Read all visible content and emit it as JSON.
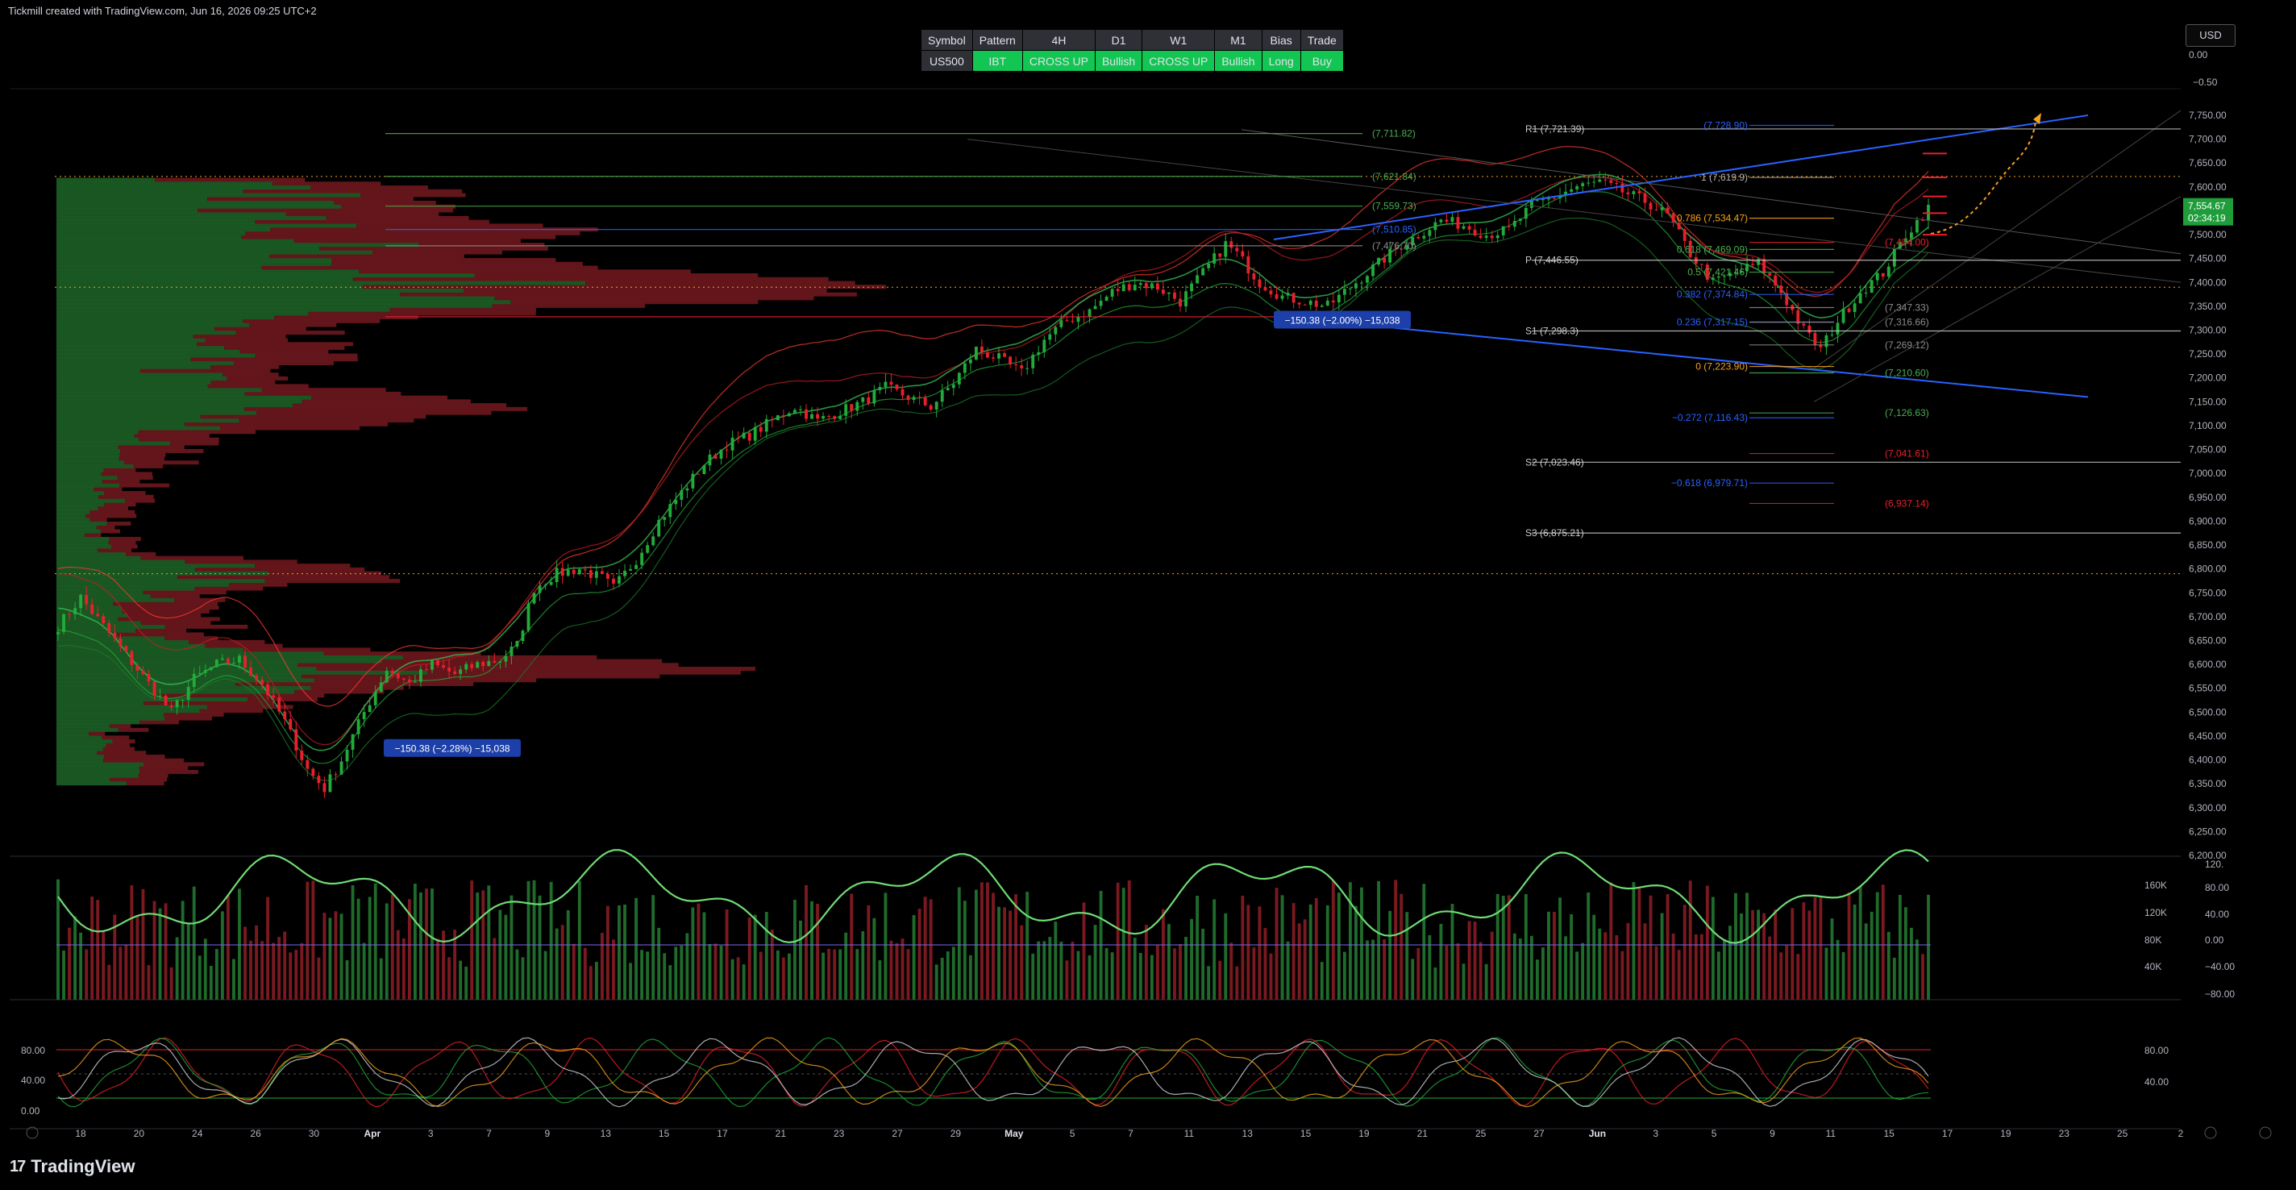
{
  "header": {
    "caption": "Tickmill created with TradingView.com, Jun 16, 2026 09:25 UTC+2",
    "currency": "USD",
    "logo_text": "TradingView",
    "logo_mark": "17"
  },
  "signal_table": {
    "headers": [
      "Symbol",
      "Pattern",
      "4H",
      "D1",
      "W1",
      "M1",
      "Bias",
      "Trade"
    ],
    "values": [
      "US500",
      "IBT",
      "CROSS UP",
      "Bullish",
      "CROSS UP",
      "Bullish",
      "Long",
      "Buy"
    ],
    "value_colors": [
      "#2f3036",
      "#13c552",
      "#13c552",
      "#13c552",
      "#13c552",
      "#13c552",
      "#13c552",
      "#13c552"
    ]
  },
  "chart_data": {
    "type": "candlestick",
    "symbol": "US500",
    "colors": {
      "up": "#22ab3a",
      "down": "#e8202c",
      "background": "#000000"
    },
    "price_axis": {
      "ylim": [
        6200,
        7750
      ],
      "ticks": [
        "7,750.00",
        "7,700.00",
        "7,650.00",
        "7,600.00",
        "7,550.00",
        "7,500.00",
        "7,450.00",
        "7,400.00",
        "7,350.00",
        "7,300.00",
        "7,250.00",
        "7,200.00",
        "7,150.00",
        "7,100.00",
        "7,050.00",
        "7,000.00",
        "6,950.00",
        "6,900.00",
        "6,850.00",
        "6,800.00",
        "6,750.00",
        "6,700.00",
        "6,650.00",
        "6,600.00",
        "6,550.00",
        "6,500.00",
        "6,450.00",
        "6,400.00",
        "6,350.00",
        "6,300.00",
        "6,250.00",
        "6,200.00"
      ],
      "top_extra_ticks": [
        "0.00",
        "−0.50"
      ],
      "last_price": "7,554.67",
      "countdown": "02:34:19"
    },
    "time_axis": {
      "ticks": [
        "18",
        "20",
        "24",
        "26",
        "30",
        "Apr",
        "3",
        "7",
        "9",
        "13",
        "15",
        "17",
        "21",
        "23",
        "27",
        "29",
        "May",
        "5",
        "7",
        "11",
        "13",
        "15",
        "19",
        "21",
        "25",
        "27",
        "Jun",
        "3",
        "5",
        "9",
        "11",
        "15",
        "17",
        "19",
        "23",
        "25",
        "2"
      ],
      "bold_ticks": [
        "Apr",
        "May",
        "Jun"
      ]
    },
    "anchor_path": [
      [
        0,
        6680
      ],
      [
        4,
        6740
      ],
      [
        8,
        6680
      ],
      [
        12,
        6620
      ],
      [
        16,
        6560
      ],
      [
        20,
        6500
      ],
      [
        24,
        6570
      ],
      [
        28,
        6600
      ],
      [
        32,
        6610
      ],
      [
        36,
        6560
      ],
      [
        40,
        6480
      ],
      [
        44,
        6380
      ],
      [
        47,
        6340
      ],
      [
        50,
        6400
      ],
      [
        54,
        6500
      ],
      [
        58,
        6590
      ],
      [
        62,
        6560
      ],
      [
        66,
        6600
      ],
      [
        70,
        6580
      ],
      [
        74,
        6600
      ],
      [
        78,
        6610
      ],
      [
        81,
        6640
      ],
      [
        84,
        6760
      ],
      [
        88,
        6790
      ],
      [
        92,
        6800
      ],
      [
        96,
        6780
      ],
      [
        98,
        6760
      ],
      [
        102,
        6820
      ],
      [
        106,
        6900
      ],
      [
        110,
        6960
      ],
      [
        114,
        7020
      ],
      [
        118,
        7060
      ],
      [
        122,
        7080
      ],
      [
        126,
        7110
      ],
      [
        130,
        7140
      ],
      [
        134,
        7110
      ],
      [
        138,
        7130
      ],
      [
        142,
        7150
      ],
      [
        146,
        7180
      ],
      [
        150,
        7160
      ],
      [
        154,
        7140
      ],
      [
        158,
        7190
      ],
      [
        162,
        7260
      ],
      [
        166,
        7240
      ],
      [
        170,
        7210
      ],
      [
        174,
        7280
      ],
      [
        178,
        7320
      ],
      [
        182,
        7340
      ],
      [
        186,
        7380
      ],
      [
        190,
        7400
      ],
      [
        194,
        7390
      ],
      [
        198,
        7360
      ],
      [
        202,
        7420
      ],
      [
        206,
        7480
      ],
      [
        208,
        7460
      ],
      [
        212,
        7400
      ],
      [
        216,
        7370
      ],
      [
        220,
        7360
      ],
      [
        224,
        7350
      ],
      [
        228,
        7390
      ],
      [
        232,
        7430
      ],
      [
        236,
        7470
      ],
      [
        240,
        7500
      ],
      [
        244,
        7530
      ],
      [
        248,
        7520
      ],
      [
        252,
        7500
      ],
      [
        256,
        7510
      ],
      [
        260,
        7560
      ],
      [
        264,
        7580
      ],
      [
        268,
        7600
      ],
      [
        272,
        7610
      ],
      [
        276,
        7590
      ],
      [
        280,
        7570
      ],
      [
        284,
        7540
      ],
      [
        288,
        7460
      ],
      [
        292,
        7400
      ],
      [
        296,
        7420
      ],
      [
        300,
        7440
      ],
      [
        304,
        7380
      ],
      [
        308,
        7300
      ],
      [
        311,
        7260
      ],
      [
        314,
        7320
      ],
      [
        318,
        7380
      ],
      [
        322,
        7420
      ],
      [
        326,
        7500
      ],
      [
        330,
        7555
      ]
    ],
    "moving_averages": [
      "#ff3b30",
      "#c81d25",
      "#22ab3a",
      "#1b7a2a",
      "#35c759"
    ],
    "levels": [
      {
        "label": "(7,711.82)",
        "price": 7711.82,
        "color": "#4caf50"
      },
      {
        "label": "(7,621.84)",
        "price": 7621.84,
        "color": "#4caf50"
      },
      {
        "label": "(7,559.73)",
        "price": 7559.73,
        "color": "#4caf50"
      },
      {
        "label": "(7,510.85)",
        "price": 7510.85,
        "color": "#2962ff"
      },
      {
        "label": "(7,476.70)",
        "price": 7476.7,
        "color": "#8d8d8d"
      },
      {
        "label": "R1 (7,721.39)",
        "price": 7721.39,
        "color": "#cccccc"
      },
      {
        "label": "(7,728.90)",
        "price": 7728.9,
        "color": "#2962ff"
      },
      {
        "label": "1 (7,619.9)",
        "price": 7619.9,
        "color": "#b0b0b0"
      },
      {
        "label": "0.786 (7,534.47)",
        "price": 7534.47,
        "color": "#f7a21b"
      },
      {
        "label": "0.618 (7,469.09)",
        "price": 7469.09,
        "color": "#4caf50"
      },
      {
        "label": "P (7,446.55)",
        "price": 7446.55,
        "color": "#cccccc"
      },
      {
        "label": "0.5 (7,421.46)",
        "price": 7421.46,
        "color": "#4caf50"
      },
      {
        "label": "0.382 (7,374.84)",
        "price": 7374.84,
        "color": "#2962ff"
      },
      {
        "label": "0.236 (7,317.15)",
        "price": 7317.15,
        "color": "#2962ff"
      },
      {
        "label": "S1 (7,298.3)",
        "price": 7298.3,
        "color": "#cccccc"
      },
      {
        "label": "0 (7,223.90)",
        "price": 7223.9,
        "color": "#f7a21b"
      },
      {
        "label": "−0.272 (7,116.43)",
        "price": 7116.43,
        "color": "#2962ff"
      },
      {
        "label": "S2 (7,023.46)",
        "price": 7023.46,
        "color": "#cccccc"
      },
      {
        "label": "−0.618 (6,979.71)",
        "price": 6979.71,
        "color": "#2962ff"
      },
      {
        "label": "S3 (6,875.21)",
        "price": 6875.21,
        "color": "#cccccc"
      },
      {
        "label": "(7,484.00)",
        "price": 7484.0,
        "color": "#e8202c"
      },
      {
        "label": "(7,347.33)",
        "price": 7347.33,
        "color": "#8d8d8d"
      },
      {
        "label": "(7,316.66)",
        "price": 7316.66,
        "color": "#8d8d8d"
      },
      {
        "label": "(7,269.12)",
        "price": 7269.12,
        "color": "#8d8d8d"
      },
      {
        "label": "(7,210.60)",
        "price": 7210.6,
        "color": "#4caf50"
      },
      {
        "label": "(7,126.63)",
        "price": 7126.63,
        "color": "#4caf50"
      },
      {
        "label": "(7,041.61)",
        "price": 7041.61,
        "color": "#e8202c"
      },
      {
        "label": "(6,937.14)",
        "price": 6937.14,
        "color": "#e8202c"
      }
    ],
    "measure_labels": [
      {
        "text": "−150.38 (−2.28%) −15,038",
        "price": 6425
      },
      {
        "text": "−150.38 (−2.00%) −15,038",
        "price": 7322
      }
    ],
    "volume_pane": {
      "left_ticks": [
        "160K",
        "120K",
        "80K",
        "40K"
      ],
      "right_ticks": [
        "120.",
        "80.00",
        "40.00",
        "0.00",
        "−40.00",
        "−80.00"
      ]
    },
    "stoch_pane": {
      "left_ticks": [
        "80.00",
        "40.00",
        "0.00"
      ],
      "right_ticks": [
        "80.00",
        "40.00"
      ]
    }
  }
}
